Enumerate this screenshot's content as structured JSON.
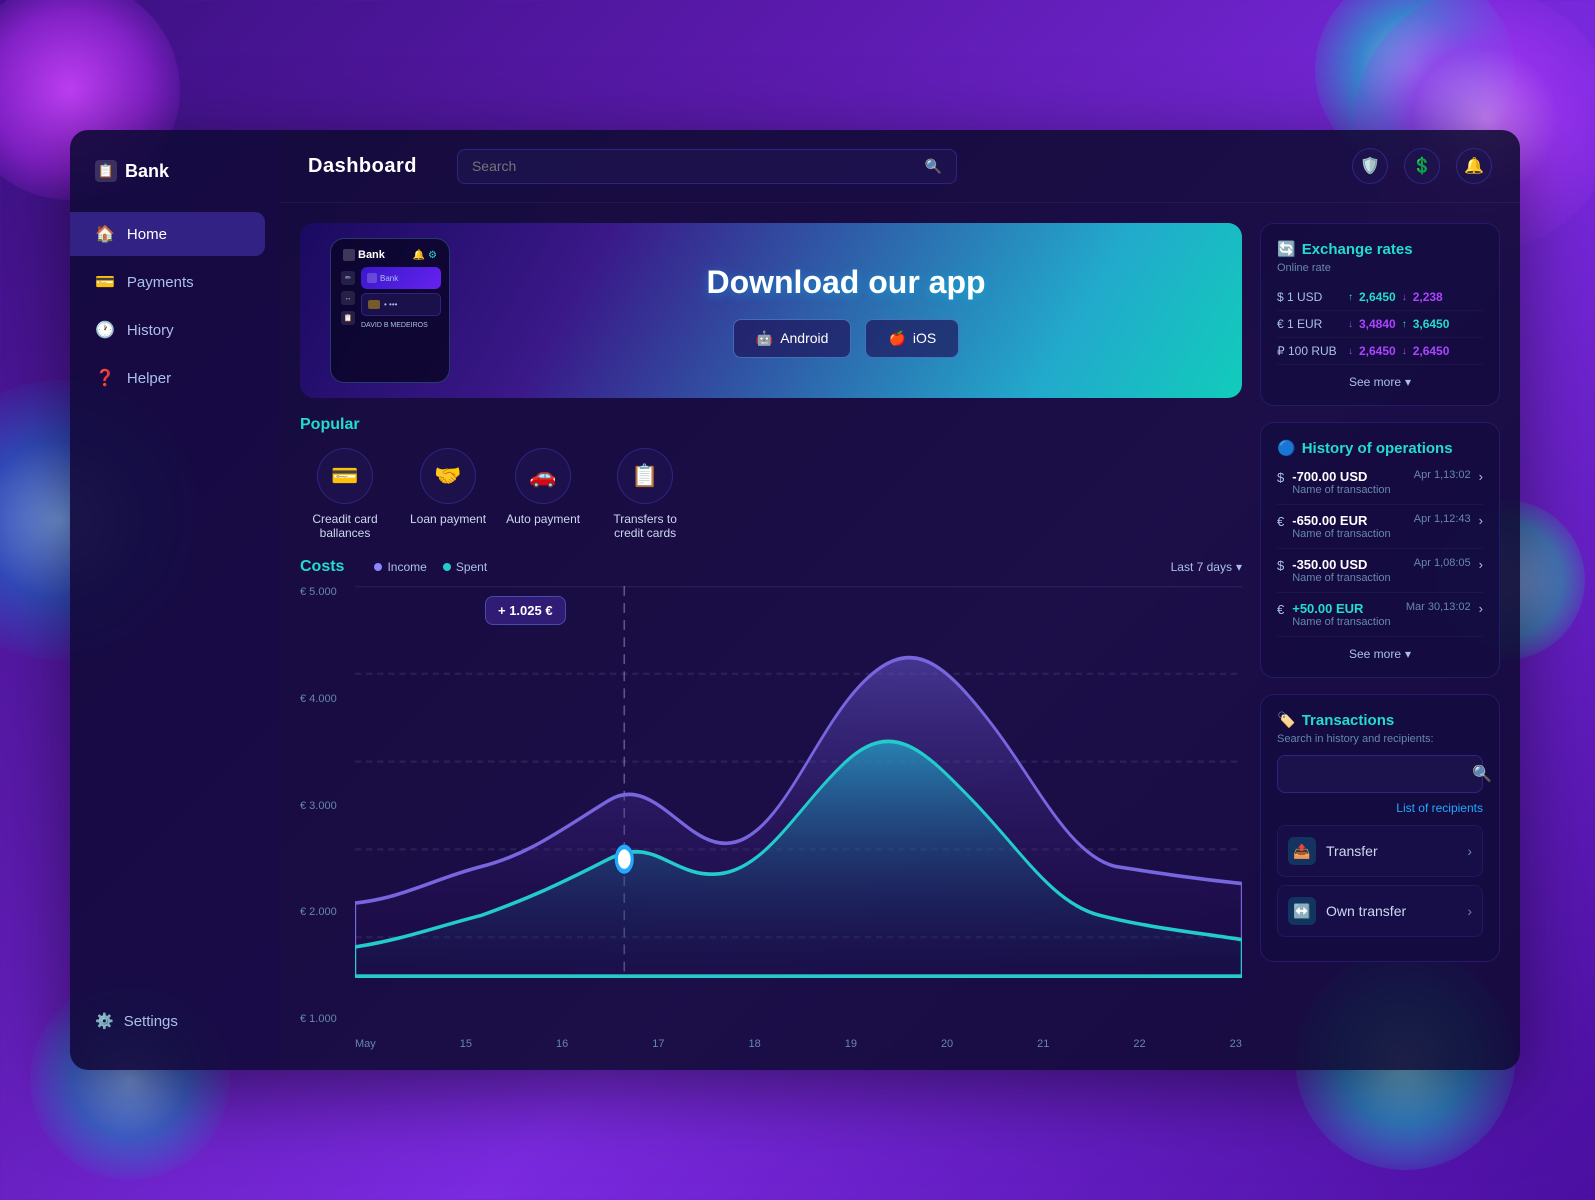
{
  "app": {
    "title": "Bank"
  },
  "header": {
    "title": "Dashboard",
    "search_placeholder": "Search",
    "icons": {
      "shield": "🛡",
      "dollar": "💲",
      "bell": "🔔"
    }
  },
  "sidebar": {
    "logo": "Bank",
    "items": [
      {
        "id": "home",
        "label": "Home",
        "icon": "🏠",
        "active": true
      },
      {
        "id": "payments",
        "label": "Payments",
        "icon": "💳"
      },
      {
        "id": "history",
        "label": "History",
        "icon": "🕐"
      },
      {
        "id": "helper",
        "label": "Helper",
        "icon": "❓"
      }
    ],
    "settings_label": "Settings",
    "settings_icon": "⚙"
  },
  "banner": {
    "title": "Download our app",
    "btn_android": "Android",
    "btn_ios": "iOS",
    "phone_bank_label": "Bank",
    "phone_inner_label": "Bank",
    "phone_name": "DAVID B MEDEIROS"
  },
  "popular": {
    "title": "Popular",
    "items": [
      {
        "label": "Creadit card ballances",
        "icon": "💳"
      },
      {
        "label": "Loan payment",
        "icon": "🤝"
      },
      {
        "label": "Auto payment",
        "icon": "🚗"
      },
      {
        "label": "Transfers to credit cards",
        "icon": "📋"
      }
    ]
  },
  "costs": {
    "title": "Costs",
    "legend": [
      {
        "label": "Income",
        "color": "#8888ff"
      },
      {
        "label": "Spent",
        "color": "#22cccc"
      }
    ],
    "filter": "Last 7 days",
    "tooltip": "+ 1.025 €",
    "y_labels": [
      "€ 5.000",
      "€ 4.000",
      "€ 3.000",
      "€ 2.000",
      "€ 1.000"
    ],
    "x_labels": [
      "May",
      "15",
      "16",
      "17",
      "18",
      "19",
      "20",
      "21",
      "22",
      "23"
    ]
  },
  "exchange_rates": {
    "title": "Exchange rates",
    "subtitle": "Online rate",
    "icon": "🔄",
    "rows": [
      {
        "currency": "$ 1 USD",
        "up_val": "2,6450",
        "down_val": "2,238",
        "up": true,
        "down": true
      },
      {
        "currency": "€ 1 EUR",
        "up_val": "3,4840",
        "down_val": "3,6450",
        "up": false,
        "down": false
      },
      {
        "currency": "₽ 100 RUB",
        "up_val": "2,6450",
        "down_val": "2,6450",
        "up": false,
        "down": false
      }
    ],
    "see_more": "See more"
  },
  "history_operations": {
    "title": "History of operations",
    "icon": "🔵",
    "items": [
      {
        "currency_icon": "$",
        "amount": "-700.00 USD",
        "positive": false,
        "name": "Name of transaction",
        "date": "Apr 1,13:02"
      },
      {
        "currency_icon": "€",
        "amount": "-650.00 EUR",
        "positive": false,
        "name": "Name of transaction",
        "date": "Apr 1,12:43"
      },
      {
        "currency_icon": "$",
        "amount": "-350.00 USD",
        "positive": false,
        "name": "Name of transaction",
        "date": "Apr 1,08:05"
      },
      {
        "currency_icon": "€",
        "amount": "+50.00 EUR",
        "positive": true,
        "name": "Name of transaction",
        "date": "Mar 30,13:02"
      }
    ],
    "see_more": "See more"
  },
  "transactions": {
    "title": "Transactions",
    "icon": "🏷",
    "search_label": "Search in history and recipients:",
    "list_of_recipients": "List of recipients",
    "items": [
      {
        "label": "Transfer",
        "icon": "📤"
      },
      {
        "label": "Own transfer",
        "icon": "↔"
      }
    ]
  }
}
